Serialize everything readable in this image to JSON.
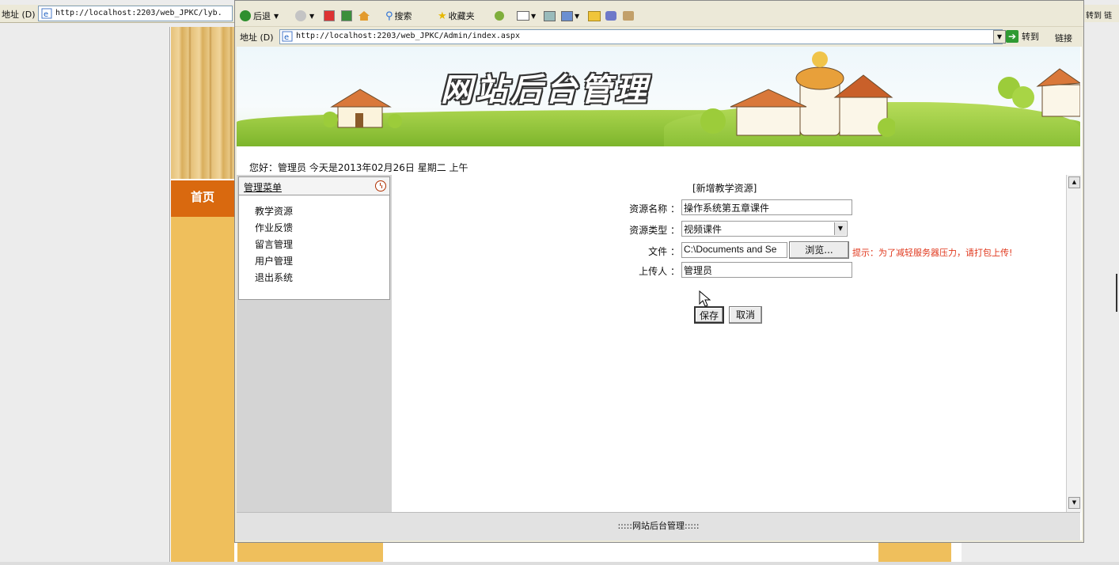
{
  "background_browser": {
    "address_label": "地址 (D)",
    "url": "http://localhost:2203/web_JPKC/lyb.",
    "right_text": "转到 链",
    "home_label": "首页"
  },
  "browser": {
    "toolbar": {
      "back_label": "后退",
      "search_label": "搜索",
      "favorites_label": "收藏夹"
    },
    "address_label": "地址 (D)",
    "url": "http://localhost:2203/web_JPKC/Admin/index.aspx",
    "go_label": "转到",
    "links_label": "链接"
  },
  "page": {
    "banner_title": "网站后台管理",
    "greeting": "您好：管理员   今天是2013年02月26日   星期二   上午",
    "menu": {
      "title": "管理菜单",
      "items": [
        "教学资源",
        "作业反馈",
        "留言管理",
        "用户管理",
        "退出系统"
      ]
    },
    "form": {
      "title": "[新增教学资源]",
      "name_label": "资源名称 ：",
      "name_value": "操作系统第五章课件",
      "type_label": "资源类型 ：",
      "type_value": "视频课件",
      "file_label": "文件 ：",
      "file_value": "C:\\Documents and Se",
      "browse_label": "浏览...",
      "hint": "提示：为了减轻服务器压力，请打包上传!",
      "uploader_label": "上传人 ：",
      "uploader_value": "管理员",
      "save_label": "保存",
      "cancel_label": "取消"
    },
    "footer": ":::::网站后台管理:::::"
  }
}
